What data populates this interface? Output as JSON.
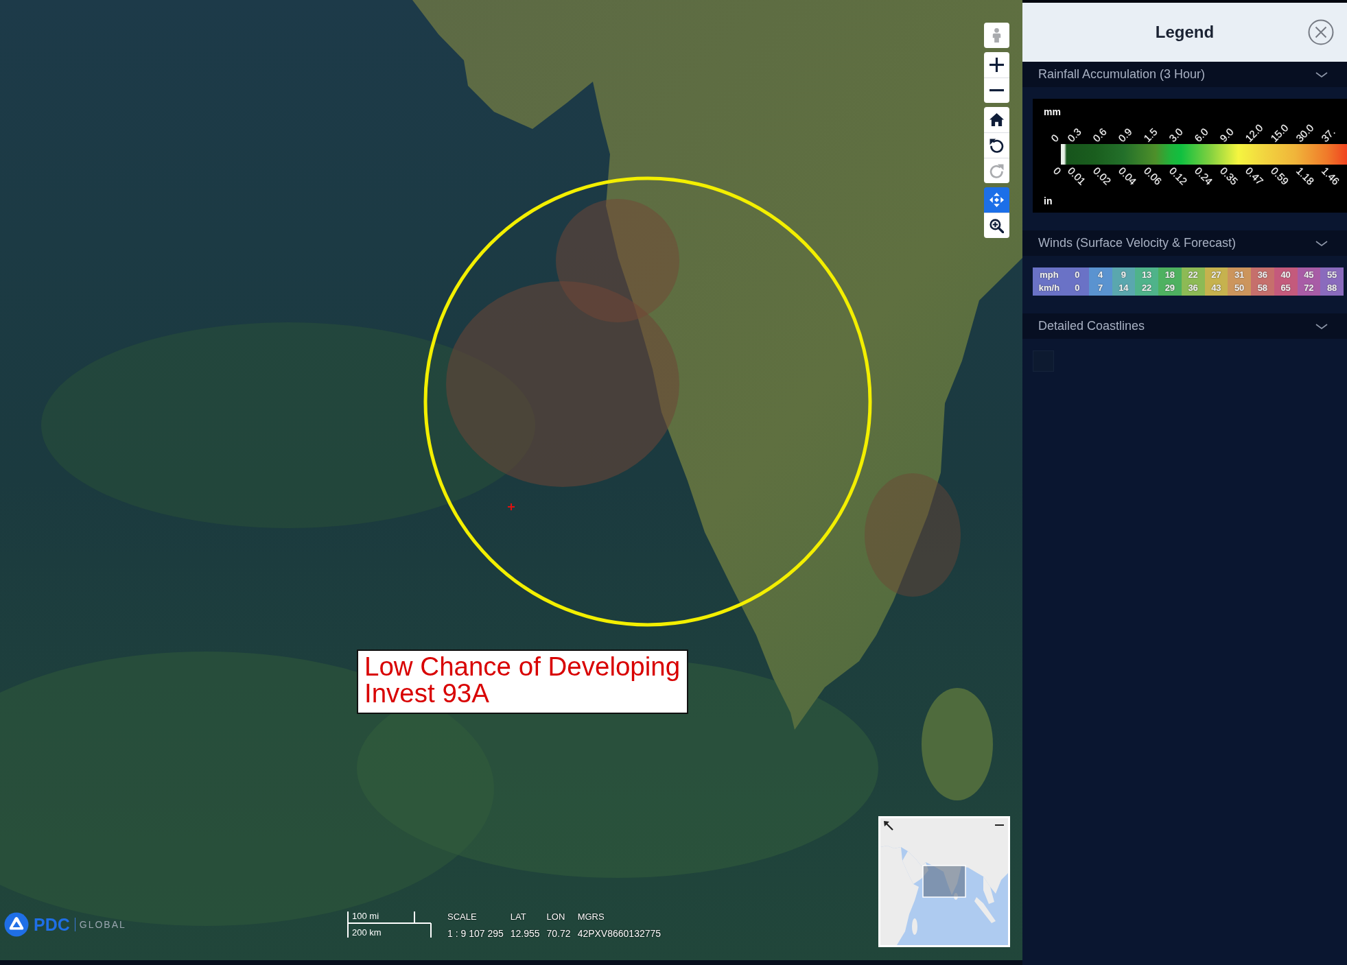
{
  "map": {
    "control_groups": [
      {
        "buttons": [
          {
            "kind": "person",
            "disabled": true
          }
        ]
      },
      {
        "buttons": [
          {
            "kind": "zoom_in",
            "disabled": false
          },
          {
            "kind": "zoom_out",
            "disabled": false
          }
        ]
      },
      {
        "buttons": [
          {
            "kind": "home",
            "disabled": false
          },
          {
            "kind": "rotate_left",
            "disabled": false
          },
          {
            "kind": "rotate_right",
            "disabled": true
          }
        ]
      },
      {
        "buttons": [
          {
            "kind": "pan",
            "disabled": false,
            "selected": true
          },
          {
            "kind": "zoom_box",
            "disabled": false,
            "selected": false
          }
        ]
      }
    ],
    "annotation": {
      "lines": [
        "Low Chance of Developing",
        "Invest 93A"
      ]
    },
    "logo": {
      "mark": "PDC",
      "suffix": "GLOBAL"
    },
    "scale_bar": {
      "upper": "100 mi",
      "lower": "200 km"
    },
    "readouts": [
      {
        "label": "SCALE",
        "value": "1 : 9 107 295"
      },
      {
        "label": "LAT",
        "value": "12.955"
      },
      {
        "label": "LON",
        "value": "70.72"
      },
      {
        "label": "MGRS",
        "value": "42PXV8660132775"
      }
    ]
  },
  "legend": {
    "title": "Legend",
    "sections": [
      {
        "kind": "gradient",
        "title": "Rainfall Accumulation (3 Hour)",
        "expanded": true,
        "upper_unit": "mm",
        "upper_ticks": [
          "0",
          "0.3",
          "0.6",
          "0.9",
          "1.5",
          "3.0",
          "6.0",
          "9.0",
          "12.0",
          "15.0",
          "30.0",
          "37."
        ],
        "lower_ticks": [
          "0",
          "0.01",
          "0.02",
          "0.04",
          "0.06",
          "0.12",
          "0.24",
          "0.35",
          "0.47",
          "0.59",
          "1.18",
          "1.46"
        ],
        "lower_unit": "in"
      },
      {
        "kind": "table",
        "title": "Winds (Surface Velocity & Forecast)",
        "expanded": true,
        "units": [
          "mph",
          "km/h"
        ],
        "columns": [
          {
            "values": [
              "0",
              "0"
            ],
            "color": "#6a72c6"
          },
          {
            "values": [
              "4",
              "7"
            ],
            "color": "#5a93d0"
          },
          {
            "values": [
              "9",
              "14"
            ],
            "color": "#5aa7ae"
          },
          {
            "values": [
              "13",
              "22"
            ],
            "color": "#4fb38a"
          },
          {
            "values": [
              "18",
              "29"
            ],
            "color": "#4eb160"
          },
          {
            "values": [
              "22",
              "36"
            ],
            "color": "#8dba55"
          },
          {
            "values": [
              "27",
              "43"
            ],
            "color": "#c6b24e"
          },
          {
            "values": [
              "31",
              "50"
            ],
            "color": "#cc955c"
          },
          {
            "values": [
              "36",
              "58"
            ],
            "color": "#c66f6c"
          },
          {
            "values": [
              "40",
              "65"
            ],
            "color": "#c45a7c"
          },
          {
            "values": [
              "45",
              "72"
            ],
            "color": "#a85ca6"
          },
          {
            "values": [
              "55",
              "88"
            ],
            "color": "#8a6bbd"
          }
        ]
      },
      {
        "kind": "checkbox",
        "title": "Detailed Coastlines",
        "expanded": true,
        "checked": false
      }
    ]
  }
}
